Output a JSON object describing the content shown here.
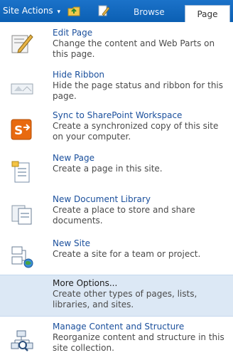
{
  "topbar": {
    "site_actions_label": "Site Actions",
    "caret": "▾",
    "tabs": [
      {
        "label": "Browse",
        "selected": false
      },
      {
        "label": "Page",
        "selected": true
      }
    ]
  },
  "menu": {
    "items": [
      {
        "title": "Edit Page",
        "description": "Change the content and Web Parts on this page.",
        "icon": "edit-page-icon",
        "highlighted": false
      },
      {
        "title": "Hide Ribbon",
        "description": "Hide the page status and ribbon for this page.",
        "icon": "hide-ribbon-icon",
        "highlighted": false
      },
      {
        "title": "Sync to SharePoint Workspace",
        "description": "Create a synchronized copy of this site on your computer.",
        "icon": "sharepoint-workspace-icon",
        "highlighted": false
      },
      {
        "title": "New Page",
        "description": "Create a page in this site.",
        "icon": "new-page-icon",
        "highlighted": false
      },
      {
        "title": "New Document Library",
        "description": "Create a place to store and share documents.",
        "icon": "document-library-icon",
        "highlighted": false
      },
      {
        "title": "New Site",
        "description": "Create a site for a team or project.",
        "icon": "new-site-icon",
        "highlighted": false
      },
      {
        "title": "More Options...",
        "description": "Create other types of pages, lists, libraries, and sites.",
        "icon": "",
        "highlighted": true
      },
      {
        "title": "Manage Content and Structure",
        "description": "Reorganize content and structure in this site collection.",
        "icon": "manage-structure-icon",
        "highlighted": false
      }
    ]
  },
  "colors": {
    "topbar": "#0b5fb3",
    "title_link": "#1a4f9c",
    "highlight": "#dce8f5"
  }
}
